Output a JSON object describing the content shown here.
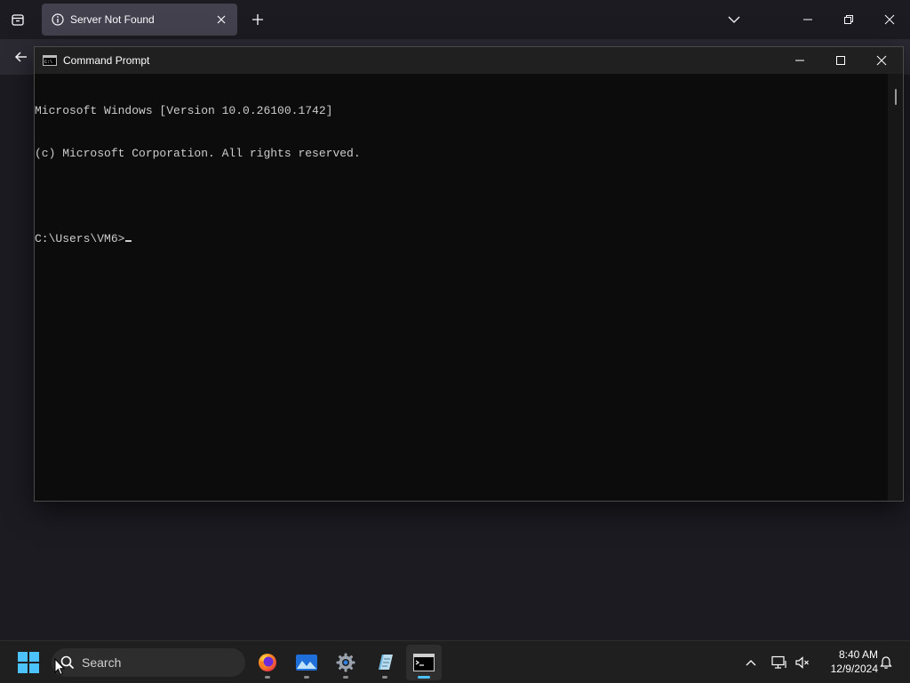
{
  "browser": {
    "tab_title": "Server Not Found"
  },
  "cmd": {
    "title": "Command Prompt",
    "lines": [
      "Microsoft Windows [Version 10.0.26100.1742]",
      "(c) Microsoft Corporation. All rights reserved.",
      "",
      "C:\\Users\\VM6>"
    ]
  },
  "taskbar": {
    "search_label": "Search",
    "apps": [
      "firefox-icon",
      "photos-icon",
      "settings-icon",
      "notepad-icon",
      "command-prompt-icon"
    ],
    "clock": {
      "time": "8:40 AM",
      "date": "12/9/2024"
    }
  },
  "colors": {
    "accent": "#4cc2ff",
    "console_bg": "#0c0c0c",
    "console_text": "#cccccc",
    "tab_bg": "#42414d"
  }
}
